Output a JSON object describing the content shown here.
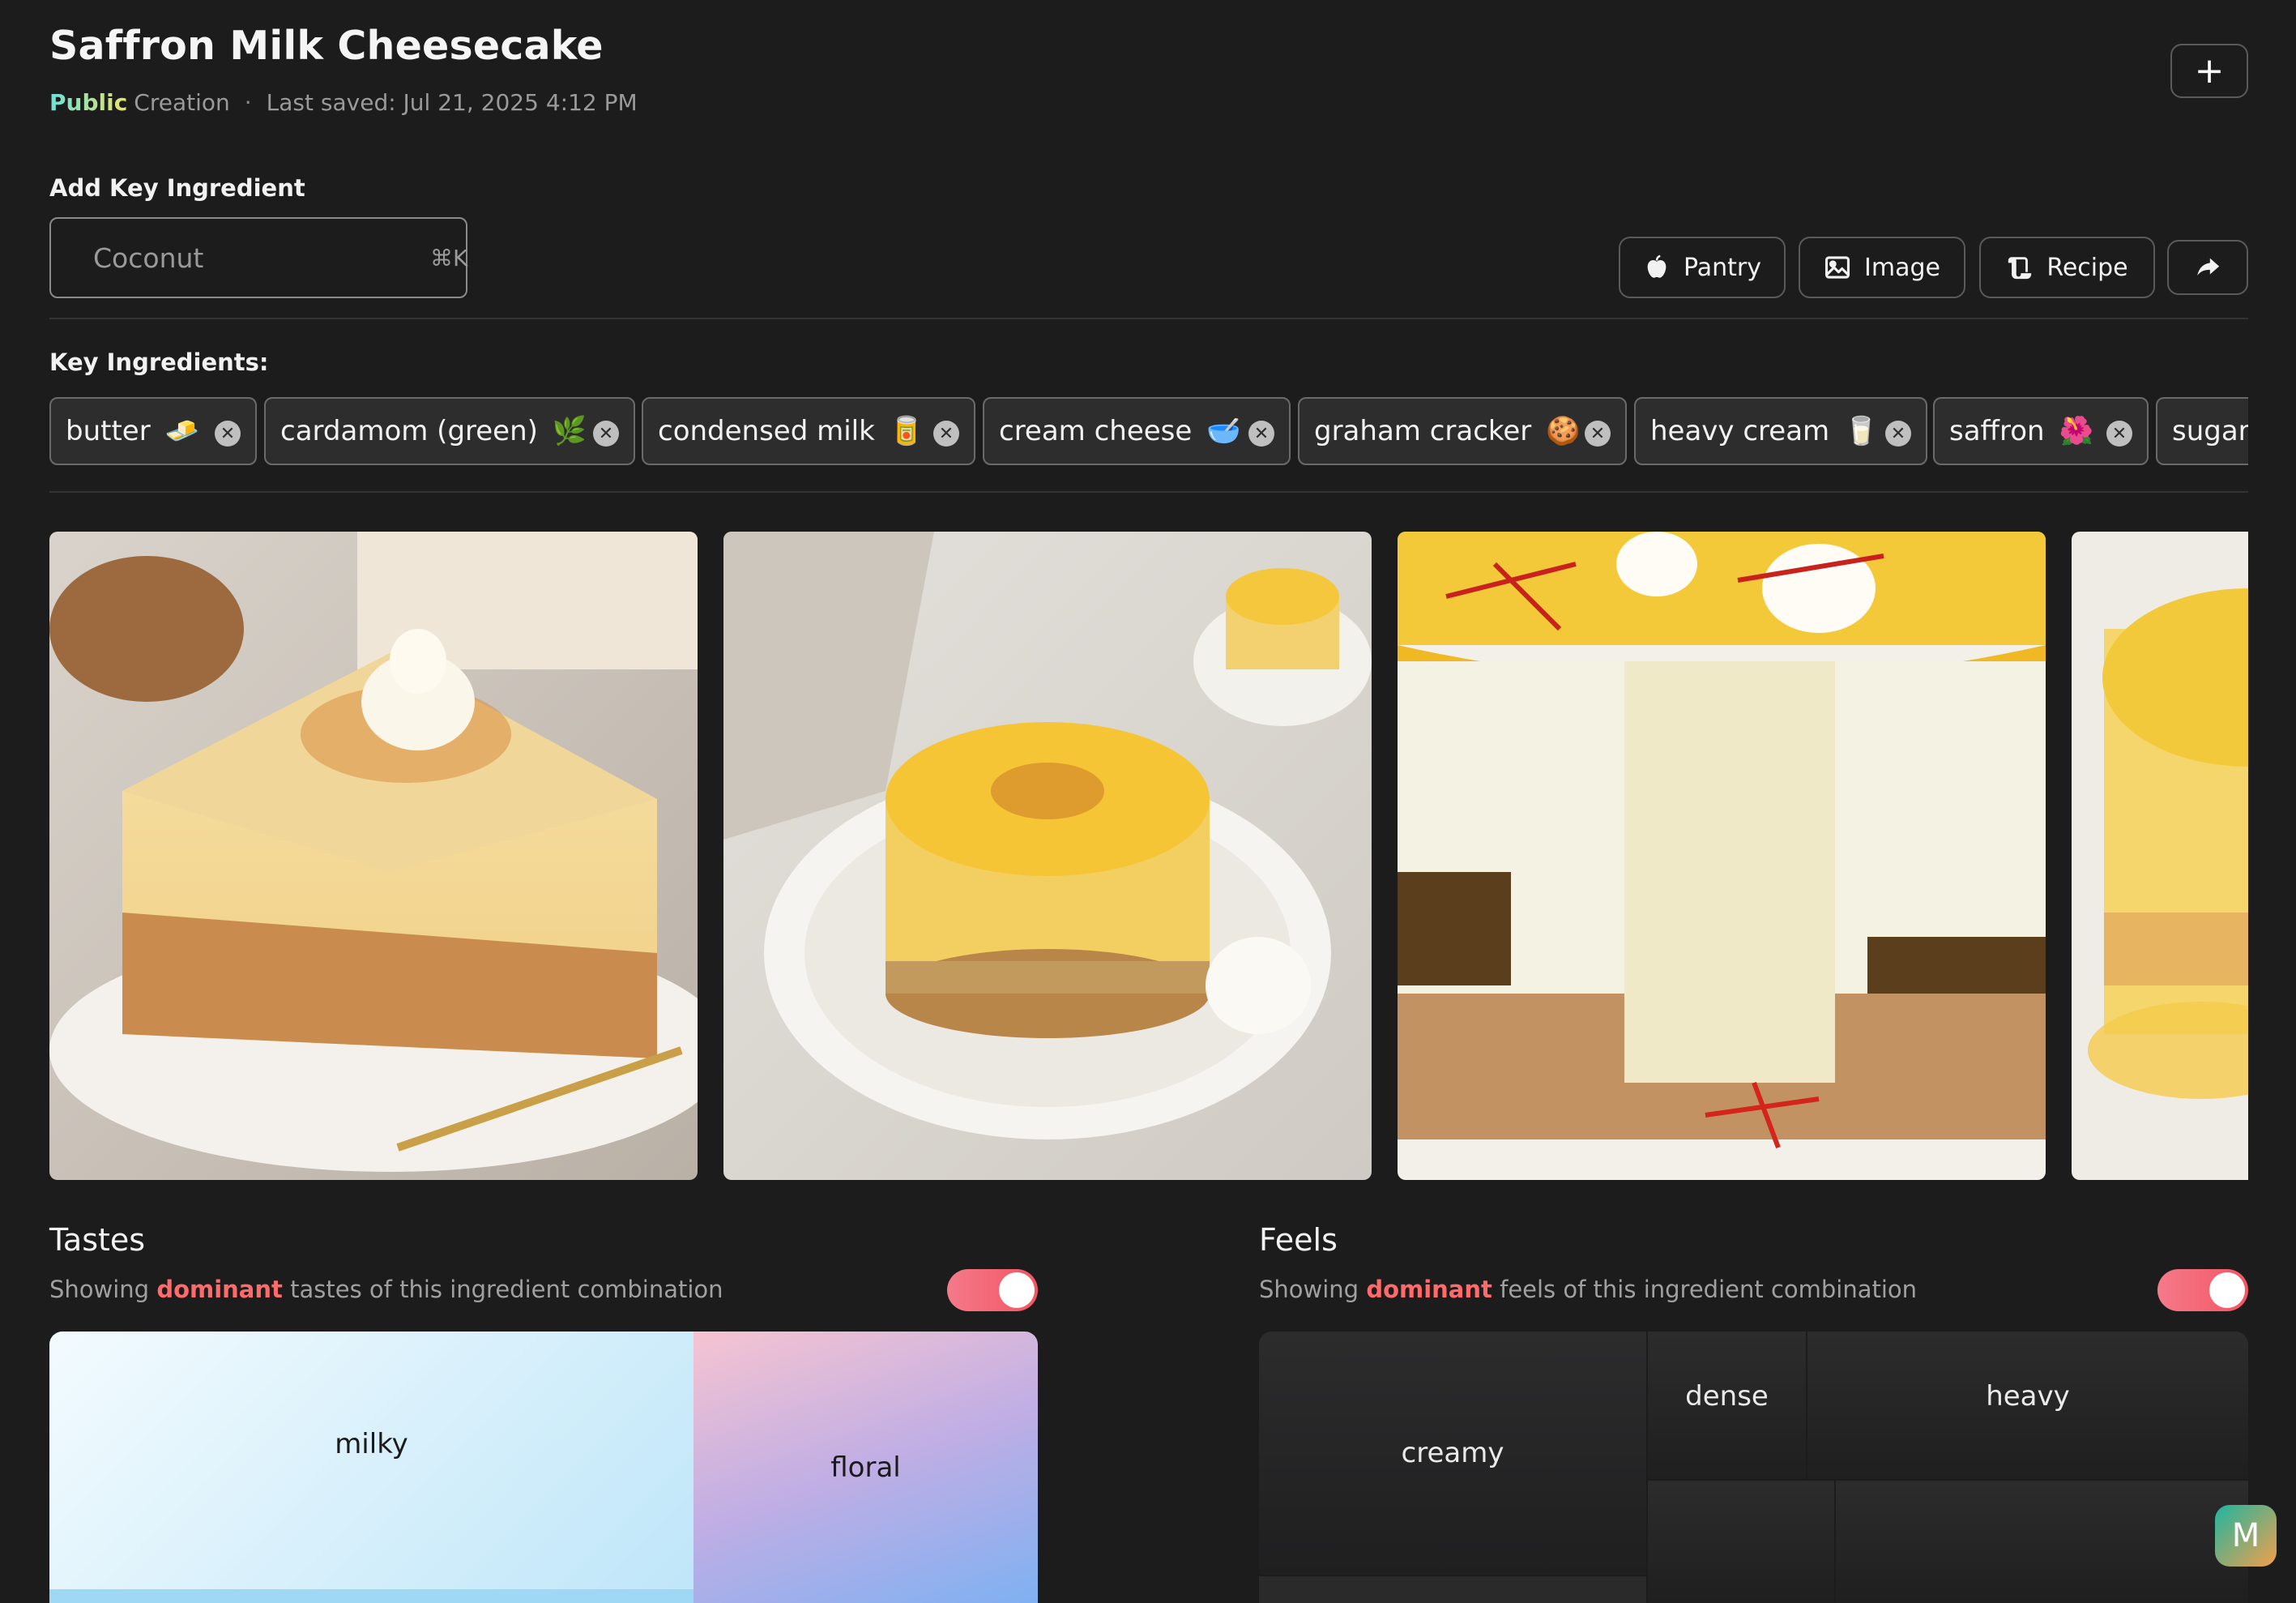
{
  "header": {
    "title": "Saffron Milk Cheesecake",
    "visibility": "Public",
    "creation_label": "Creation",
    "separator": "·",
    "last_saved": "Last saved: Jul 21, 2025 4:12 PM",
    "add_button_label": "+"
  },
  "add_ingredient": {
    "label": "Add Key Ingredient",
    "placeholder": "Coconut",
    "shortcut": "⌘K"
  },
  "toolbar": {
    "pantry_label": "Pantry",
    "image_label": "Image",
    "recipe_label": "Recipe"
  },
  "key_ingredients": {
    "label": "Key Ingredients:",
    "items": [
      {
        "name": "butter",
        "emoji": "🧈"
      },
      {
        "name": "cardamom (green)",
        "emoji": "🌿"
      },
      {
        "name": "condensed milk",
        "emoji": "🥫"
      },
      {
        "name": "cream cheese",
        "emoji": "🥣"
      },
      {
        "name": "graham cracker",
        "emoji": "🍪"
      },
      {
        "name": "heavy cream",
        "emoji": "🥛"
      },
      {
        "name": "saffron",
        "emoji": "🌺"
      },
      {
        "name": "sugar",
        "emoji": ""
      }
    ],
    "remove_glyph": "✕"
  },
  "tastes": {
    "title": "Tastes",
    "sub_prefix": "Showing ",
    "sub_highlight": "dominant",
    "sub_suffix": " tastes of this ingredient combination",
    "toggle_on": true,
    "tiles": [
      "milky",
      "floral"
    ]
  },
  "feels": {
    "title": "Feels",
    "sub_prefix": "Showing ",
    "sub_highlight": "dominant",
    "sub_suffix": " feels of this ingredient combination",
    "toggle_on": true,
    "tiles": [
      "creamy",
      "dense",
      "heavy"
    ]
  },
  "badge": {
    "letter": "M"
  },
  "colors": {
    "background": "#1c1c1d",
    "accent_red": "#ff6b6b",
    "toggle": "#f25563"
  }
}
